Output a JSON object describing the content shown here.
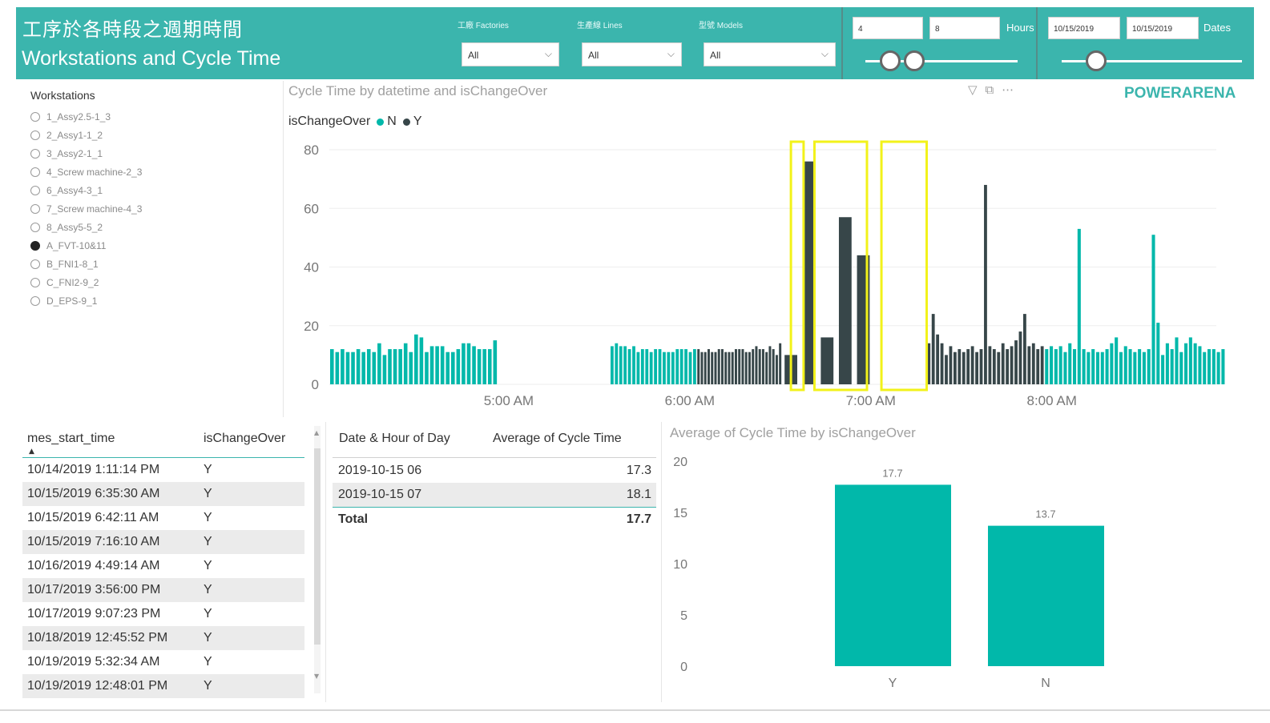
{
  "header": {
    "title_zh": "工序於各時段之週期時間",
    "title_en": "Workstations and Cycle Time",
    "filters": [
      {
        "label": "工廠 Factories",
        "value": "All"
      },
      {
        "label": "生產線 Lines",
        "value": "All"
      },
      {
        "label": "型號 Models",
        "value": "All"
      }
    ],
    "hours": {
      "from": "4",
      "to": "8",
      "unit": "Hours"
    },
    "dates": {
      "from": "10/15/2019",
      "to": "10/15/2019",
      "unit": "Dates"
    }
  },
  "brand": "POWERARENA",
  "workstations": {
    "title": "Workstations",
    "items": [
      {
        "label": "1_Assy2.5-1_3",
        "selected": false
      },
      {
        "label": "2_Assy1-1_2",
        "selected": false
      },
      {
        "label": "3_Assy2-1_1",
        "selected": false
      },
      {
        "label": "4_Screw machine-2_3",
        "selected": false
      },
      {
        "label": "6_Assy4-3_1",
        "selected": false
      },
      {
        "label": "7_Screw machine-4_3",
        "selected": false
      },
      {
        "label": "8_Assy5-5_2",
        "selected": false
      },
      {
        "label": "A_FVT-10&11",
        "selected": true
      },
      {
        "label": "B_FNI1-8_1",
        "selected": false
      },
      {
        "label": "C_FNI2-9_2",
        "selected": false
      },
      {
        "label": "D_EPS-9_1",
        "selected": false
      }
    ]
  },
  "main_chart": {
    "title": "Cycle Time by datetime and isChangeOver",
    "legend_title": "isChangeOver",
    "legend": [
      {
        "name": "N",
        "color": "#01b8aa"
      },
      {
        "name": "Y",
        "color": "#374649"
      }
    ]
  },
  "log_table": {
    "headers": [
      "mes_start_time",
      "isChangeOver"
    ],
    "rows": [
      [
        "10/14/2019 1:11:14 PM",
        "Y"
      ],
      [
        "10/15/2019 6:35:30 AM",
        "Y"
      ],
      [
        "10/15/2019 6:42:11 AM",
        "Y"
      ],
      [
        "10/15/2019 7:16:10 AM",
        "Y"
      ],
      [
        "10/16/2019 4:49:14 AM",
        "Y"
      ],
      [
        "10/17/2019 3:56:00 PM",
        "Y"
      ],
      [
        "10/17/2019 9:07:23 PM",
        "Y"
      ],
      [
        "10/18/2019 12:45:52 PM",
        "Y"
      ],
      [
        "10/19/2019 5:32:34 AM",
        "Y"
      ],
      [
        "10/19/2019 12:48:01 PM",
        "Y"
      ]
    ]
  },
  "agg_table": {
    "headers": [
      "Date & Hour of Day",
      "Average of Cycle Time"
    ],
    "rows": [
      [
        "2019-10-15 06",
        "17.3"
      ],
      [
        "2019-10-15 07",
        "18.1"
      ]
    ],
    "total": [
      "Total",
      "17.7"
    ]
  },
  "chart_data": [
    {
      "type": "bar",
      "title": "Cycle Time by datetime and isChangeOver",
      "xlabel": "",
      "ylabel": "",
      "ylim": [
        0,
        80
      ],
      "y_ticks": [
        0,
        20,
        40,
        60,
        80
      ],
      "x_ticks": [
        "5:00 AM",
        "6:00 AM",
        "7:00 AM",
        "8:00 AM"
      ],
      "x_range_minutes": [
        4.0,
        8.9
      ],
      "series_colors": {
        "N": "#01b8aa",
        "Y": "#374649"
      },
      "groups": [
        {
          "series": "N",
          "start": 4.0,
          "end": 4.93,
          "values": [
            12,
            11,
            12,
            11,
            11,
            12,
            11,
            12,
            11,
            14,
            10,
            12,
            12,
            12,
            14,
            11,
            17,
            16,
            11,
            13,
            13,
            13,
            11,
            11,
            12,
            14,
            14,
            13,
            12,
            12,
            12,
            15
          ]
        },
        {
          "series": "N",
          "start": 5.55,
          "end": 6.03,
          "values": [
            13,
            14,
            13,
            13,
            12,
            13,
            11,
            12,
            12,
            11,
            12,
            12,
            11,
            11,
            11,
            12,
            12,
            12,
            11,
            12
          ]
        },
        {
          "series": "Y",
          "start": 6.03,
          "end": 6.5,
          "values": [
            12,
            11,
            11,
            12,
            11,
            11,
            12,
            12,
            11,
            11,
            11,
            12,
            12,
            12,
            11,
            11,
            12,
            13,
            12,
            12,
            11,
            13,
            12,
            10,
            14
          ]
        },
        {
          "series": "Y",
          "start": 6.5,
          "end": 7.0,
          "values": [
            10,
            76,
            16,
            57,
            44
          ]
        },
        {
          "series": "Y",
          "start": 7.3,
          "end": 7.95,
          "values": [
            14,
            24,
            17,
            14,
            10,
            13,
            11,
            12,
            11,
            12,
            13,
            11,
            12,
            68,
            13,
            12,
            11,
            14,
            12,
            13,
            15,
            18,
            24,
            13,
            14,
            12,
            13
          ]
        },
        {
          "series": "N",
          "start": 7.95,
          "end": 8.95,
          "values": [
            12,
            13,
            12,
            13,
            11,
            14,
            12,
            53,
            12,
            11,
            12,
            11,
            11,
            12,
            14,
            16,
            11,
            13,
            12,
            11,
            12,
            11,
            12,
            51,
            21,
            10,
            14,
            12,
            16,
            11,
            14,
            16,
            14,
            13,
            11,
            12,
            12,
            11,
            12
          ]
        }
      ],
      "highlight_boxes_time": [
        [
          6.55,
          6.62
        ],
        [
          6.68,
          6.97
        ],
        [
          7.05,
          7.3
        ]
      ]
    },
    {
      "type": "bar",
      "title": "Average of Cycle Time by isChangeOver",
      "categories": [
        "Y",
        "N"
      ],
      "values": [
        17.7,
        13.7
      ],
      "value_labels": [
        "17.7",
        "13.7"
      ],
      "ylim": [
        0,
        20
      ],
      "y_ticks": [
        0,
        5,
        10,
        15,
        20
      ],
      "color": "#01b8aa"
    }
  ]
}
